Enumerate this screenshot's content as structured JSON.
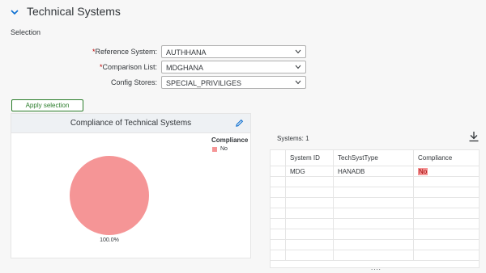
{
  "section": {
    "title": "Technical Systems",
    "selection_label": "Selection"
  },
  "form": {
    "reference_system": {
      "label": "Reference System:",
      "required": "*",
      "value": "AUTHHANA"
    },
    "comparison_list": {
      "label": "Comparison List:",
      "required": "*",
      "value": "MDGHANA"
    },
    "config_stores": {
      "label": "Config Stores:",
      "value": "SPECIAL_PRIVILIGES"
    }
  },
  "apply_button": "Apply selection",
  "chart": {
    "title": "Compliance of Technical Systems",
    "legend_title": "Compliance",
    "legend_items": [
      {
        "label": "No",
        "color": "#f59596"
      }
    ],
    "percent_label": "100.0%"
  },
  "chart_data": {
    "type": "pie",
    "title": "Compliance of Technical Systems",
    "categories": [
      "No"
    ],
    "values": [
      100.0
    ],
    "colors": [
      "#f59596"
    ],
    "legend_title": "Compliance",
    "legend_position": "top-right",
    "data_labels": [
      "100.0%"
    ]
  },
  "table": {
    "count_label": "Systems: 1",
    "columns": [
      "System ID",
      "TechSystType",
      "Compliance"
    ],
    "rows": [
      [
        "MDG",
        "HANADB",
        "No"
      ]
    ],
    "more": "...."
  },
  "colors": {
    "accent": "#0a6ed1",
    "button_green": "#2b7d2b",
    "no_color": "#f59596",
    "required": "#bb0000"
  }
}
